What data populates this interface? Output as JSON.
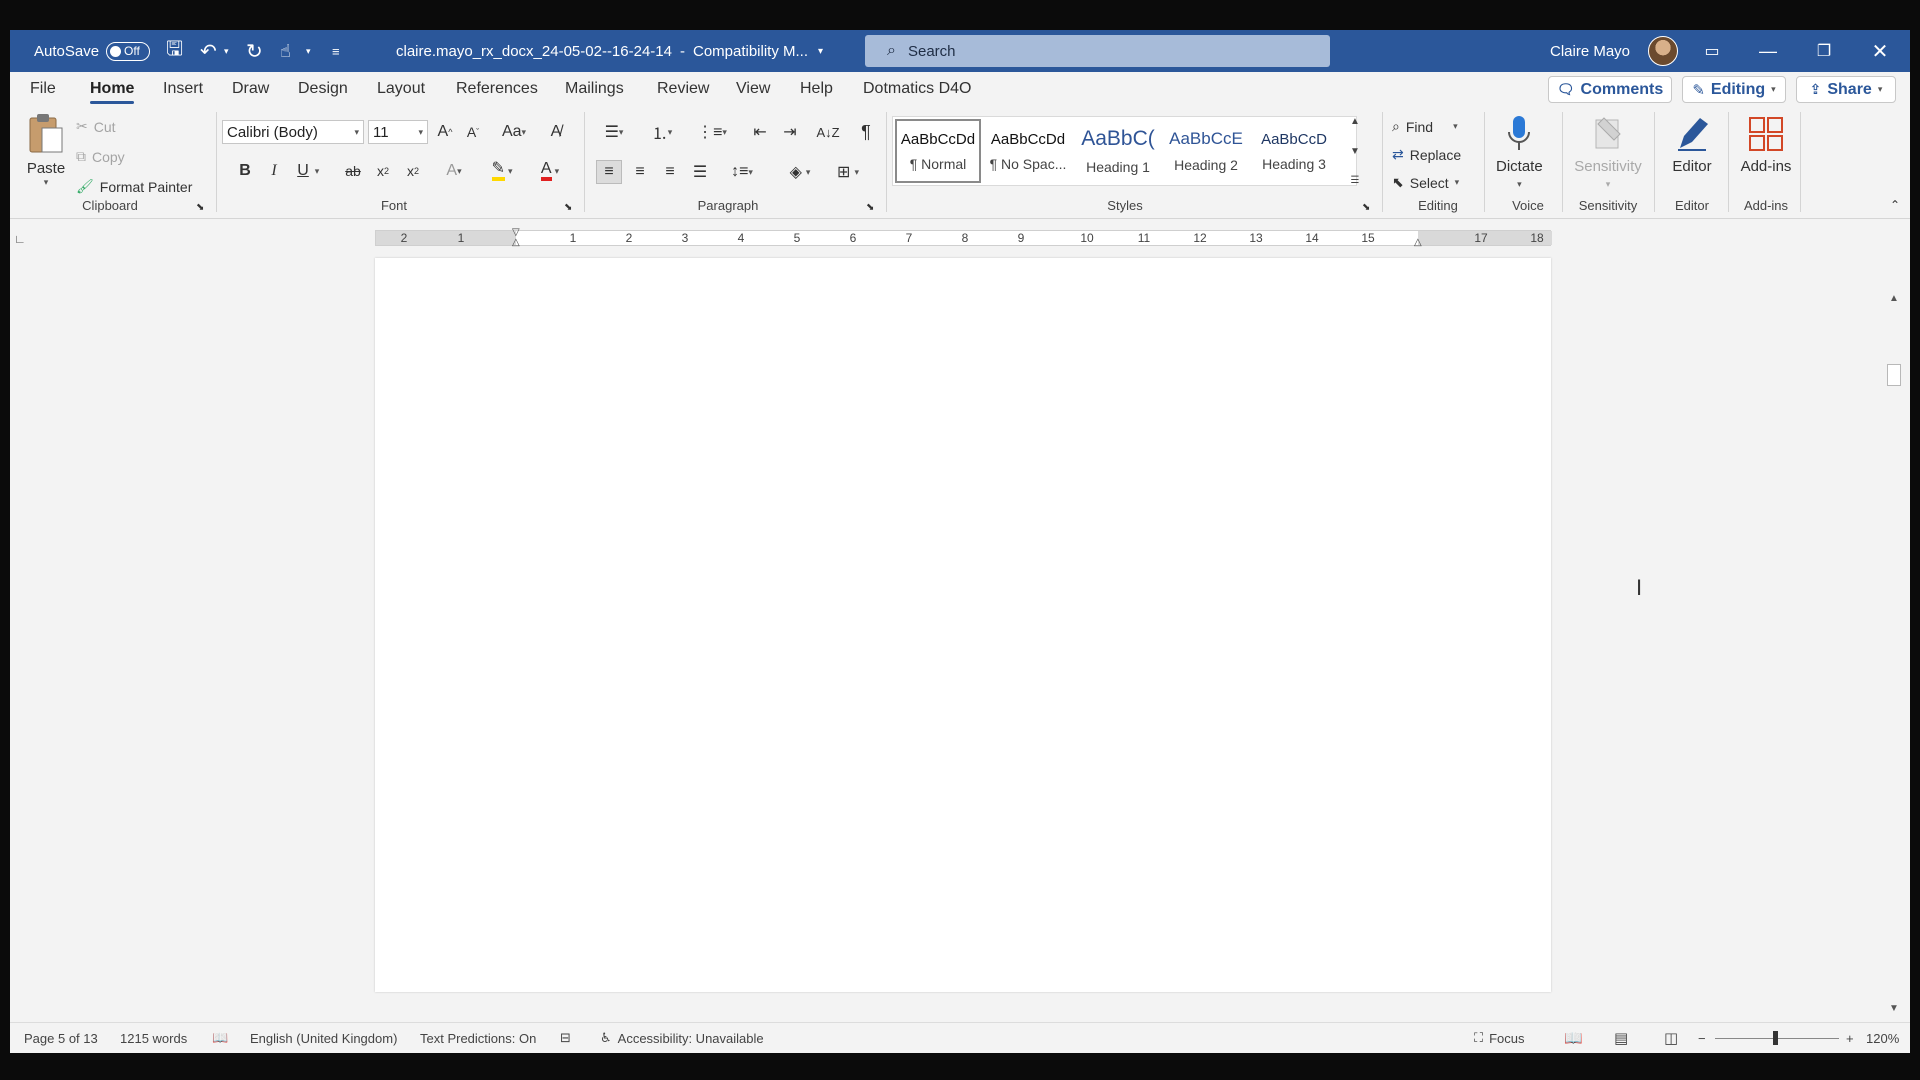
{
  "titlebar": {
    "autosave_label": "AutoSave",
    "autosave_state": "Off",
    "doc_title": "claire.mayo_rx_docx_24-05-02--16-24-14",
    "mode": "Compatibility M...",
    "search_placeholder": "Search",
    "user_name": "Claire Mayo"
  },
  "menu": {
    "items": [
      "File",
      "Home",
      "Insert",
      "Draw",
      "Design",
      "Layout",
      "References",
      "Mailings",
      "Review",
      "View",
      "Help",
      "Dotmatics D4O"
    ],
    "active": "Home",
    "comments_label": "Comments",
    "editing_label": "Editing",
    "share_label": "Share"
  },
  "ribbon": {
    "clipboard": {
      "label": "Clipboard",
      "paste": "Paste",
      "cut": "Cut",
      "copy": "Copy",
      "format_painter": "Format Painter"
    },
    "font": {
      "label": "Font",
      "family": "Calibri (Body)",
      "size": "11"
    },
    "paragraph": {
      "label": "Paragraph"
    },
    "styles": {
      "label": "Styles",
      "items": [
        {
          "sample": "AaBbCcDd",
          "name": "¶ Normal"
        },
        {
          "sample": "AaBbCcDd",
          "name": "¶ No Spac..."
        },
        {
          "sample": "AaBbC(",
          "name": "Heading 1"
        },
        {
          "sample": "AaBbCcE",
          "name": "Heading 2"
        },
        {
          "sample": "AaBbCcD",
          "name": "Heading 3"
        }
      ]
    },
    "editing": {
      "label": "Editing",
      "find": "Find",
      "replace": "Replace",
      "select": "Select"
    },
    "voice": {
      "label": "Voice",
      "dictate": "Dictate"
    },
    "sensitivity": {
      "label": "Sensitivity",
      "button": "Sensitivity"
    },
    "editor": {
      "label": "Editor",
      "button": "Editor"
    },
    "addins": {
      "label": "Add-ins",
      "button": "Add-ins"
    }
  },
  "ruler": {
    "left_nums": [
      "2",
      "1"
    ],
    "nums": [
      "1",
      "2",
      "3",
      "4",
      "5",
      "6",
      "7",
      "8",
      "9",
      "10",
      "11",
      "12",
      "13",
      "14",
      "15",
      "17",
      "18"
    ]
  },
  "status": {
    "page": "Page 5 of 13",
    "words": "1215 words",
    "language": "English (United Kingdom)",
    "predictions": "Text Predictions: On",
    "accessibility": "Accessibility: Unavailable",
    "focus": "Focus",
    "zoom": "120%"
  },
  "colors": {
    "brand": "#2b579a",
    "highlight": "#ffd800",
    "font_color": "#e02020"
  }
}
